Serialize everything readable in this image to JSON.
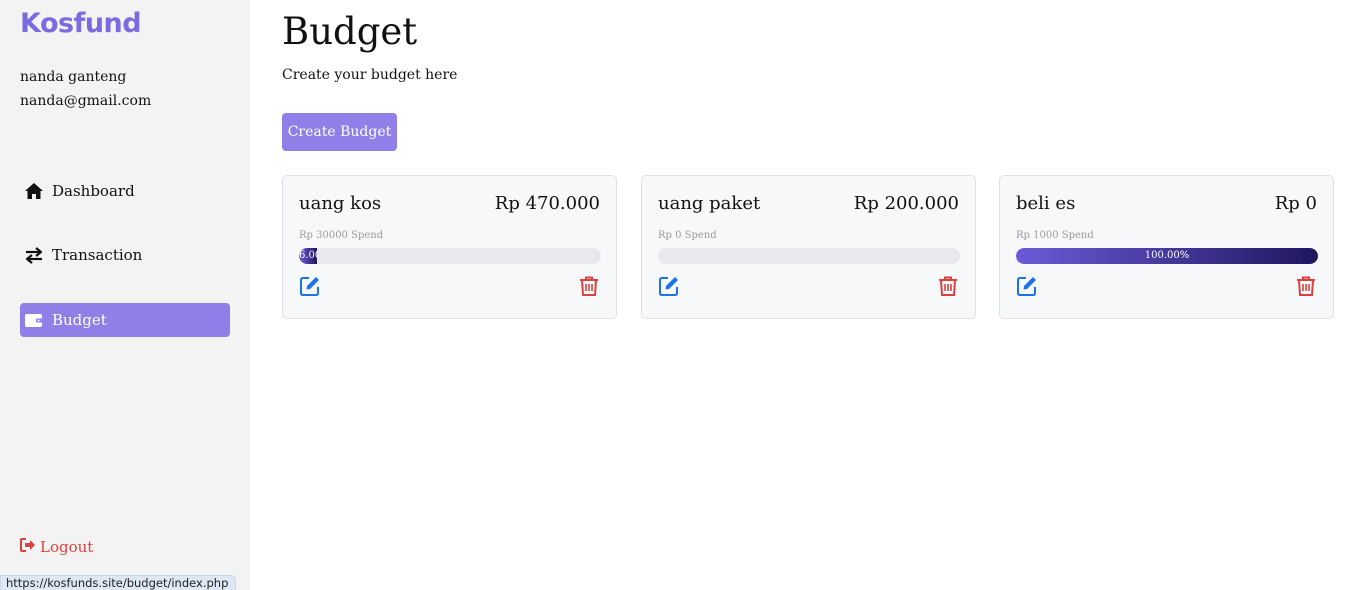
{
  "brand": {
    "name": "Kosfund",
    "color": "#7b6be0"
  },
  "user": {
    "name": "nanda ganteng",
    "email": "nanda@gmail.com"
  },
  "nav": {
    "items": [
      {
        "label": "Dashboard",
        "icon": "home-icon",
        "active": false
      },
      {
        "label": "Transaction",
        "icon": "swap-arrows-icon",
        "active": false
      },
      {
        "label": "Budget",
        "icon": "wallet-icon",
        "active": true
      }
    ],
    "logout_label": "Logout"
  },
  "page": {
    "title": "Budget",
    "subtitle": "Create your budget here",
    "create_button_label": "Create Budget"
  },
  "budgets": [
    {
      "name": "uang kos",
      "amount": "Rp 470.000",
      "spend": "Rp 30000 Spend",
      "progress_percent": 6,
      "progress_label": "6.00%"
    },
    {
      "name": "uang paket",
      "amount": "Rp 200.000",
      "spend": "Rp 0 Spend",
      "progress_percent": 0,
      "progress_label": ""
    },
    {
      "name": "beli es",
      "amount": "Rp 0",
      "spend": "Rp 1000 Spend",
      "progress_percent": 100,
      "progress_label": "100.00%"
    }
  ],
  "status_bar": {
    "url": "https://kosfunds.site/budget/index.php"
  },
  "colors": {
    "accent": "#8f7fe6",
    "danger": "#d9423f",
    "edit_blue": "#1a73e8",
    "progress_start": "#6c5bd9",
    "progress_end": "#1f165e"
  }
}
